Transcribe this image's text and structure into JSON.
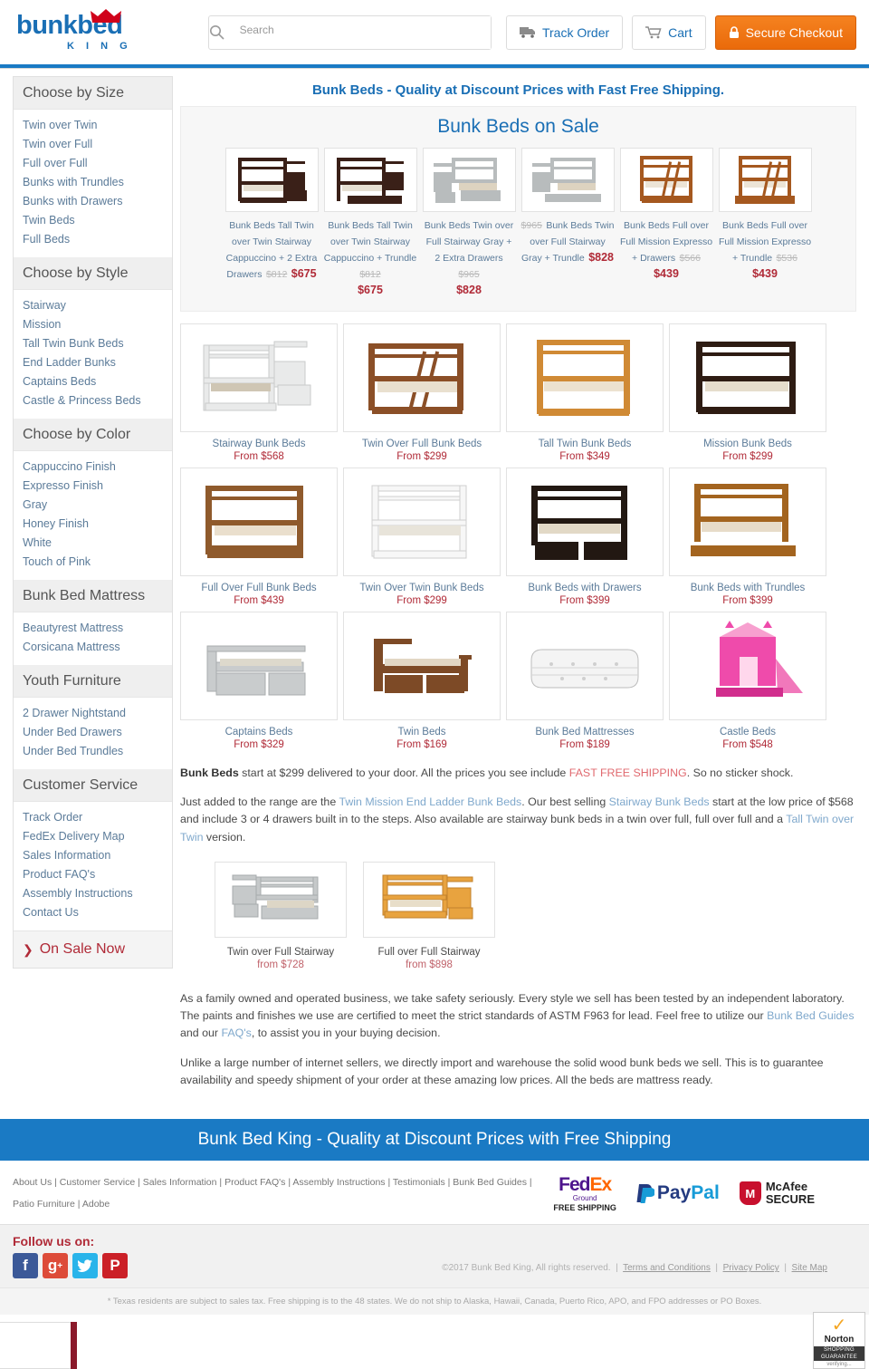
{
  "header": {
    "logo_main": "bunkbed",
    "logo_sub": "K I N G",
    "search_placeholder": "Search",
    "search_value": "",
    "track_order": "Track Order",
    "cart": "Cart",
    "secure_checkout": "Secure Checkout",
    "accent_orange": "#f58220",
    "accent_blue": "#1a7ac4"
  },
  "sidebar": {
    "sections": [
      {
        "title": "Choose by Size",
        "items": [
          "Twin over Twin",
          "Twin over Full",
          "Full over Full",
          "Bunks with Trundles",
          "Bunks with Drawers",
          "Twin Beds",
          "Full Beds"
        ]
      },
      {
        "title": "Choose by Style",
        "items": [
          "Stairway",
          "Mission",
          "Tall Twin Bunk Beds",
          "End Ladder Bunks",
          "Captains Beds",
          "Castle & Princess Beds"
        ]
      },
      {
        "title": "Choose by Color",
        "items": [
          "Cappuccino Finish",
          "Expresso Finish",
          "Gray",
          "Honey Finish",
          "White",
          "Touch of Pink"
        ]
      },
      {
        "title": "Bunk Bed Mattress",
        "items": [
          "Beautyrest Mattress",
          "Corsicana Mattress"
        ]
      },
      {
        "title": "Youth Furniture",
        "items": [
          "2 Drawer Nightstand",
          "Under Bed Drawers",
          "Under Bed Trundles"
        ]
      },
      {
        "title": "Customer Service",
        "items": [
          "Track Order",
          "FedEx Delivery Map",
          "Sales Information",
          "Product FAQ's",
          "Assembly Instructions",
          "Contact Us"
        ]
      }
    ],
    "on_sale_now": "On Sale Now"
  },
  "main": {
    "tagline": "Bunk Beds - Quality at Discount Prices with Fast Free Shipping.",
    "sale_title": "Bunk Beds on Sale",
    "sale_items": [
      {
        "name": "Bunk Beds Tall Twin over Twin Stairway Cappuccino + 2 Extra Drawers",
        "old_price": "$812",
        "price": "$675",
        "color": "#3a2018"
      },
      {
        "name": "Bunk Beds Tall Twin over Twin Stairway Cappuccino + Trundle",
        "old_price": "$812",
        "price": "$675",
        "color": "#3a2018"
      },
      {
        "name": "Bunk Beds Twin over Full Stairway Gray + 2 Extra Drawers",
        "old_price": "$965",
        "price": "$828",
        "color": "#b8bcbd"
      },
      {
        "name": "Bunk Beds Twin over Full Stairway Gray + Trundle",
        "old_price": "$965",
        "price": "$828",
        "color": "#b8bcbd"
      },
      {
        "name": "Bunk Beds Full over Full Mission Expresso + Drawers",
        "old_price": "$566",
        "price": "$439",
        "color": "#a5581f"
      },
      {
        "name": "Bunk Beds Full over Full Mission Expresso + Trundle",
        "old_price": "$536",
        "price": "$439",
        "color": "#a5581f"
      }
    ],
    "categories": [
      {
        "name": "Stairway Bunk Beds",
        "price": "From $568",
        "color": "#e9eaea",
        "stroke": "#c9cbcb"
      },
      {
        "name": "Twin Over Full Bunk Beds",
        "price": "From $299",
        "color": "#8b4f27",
        "stroke": "#6d3c1c"
      },
      {
        "name": "Tall Twin Bunk Beds",
        "price": "From $349",
        "color": "#d08a35",
        "stroke": "#a96c26"
      },
      {
        "name": "Mission Bunk Beds",
        "price": "From $299",
        "color": "#2e1c13",
        "stroke": "#1b100a"
      },
      {
        "name": "Full Over Full Bunk Beds",
        "price": "From $439",
        "color": "#8f5a2c",
        "stroke": "#6d4220"
      },
      {
        "name": "Twin Over Twin Bunk Beds",
        "price": "From $299",
        "color": "#f2f2f2",
        "stroke": "#cfcfcf"
      },
      {
        "name": "Bunk Beds with Drawers",
        "price": "From $399",
        "color": "#221812",
        "stroke": "#120c08"
      },
      {
        "name": "Bunk Beds with Trundles",
        "price": "From $399",
        "color": "#a3641f",
        "stroke": "#7d4b16"
      },
      {
        "name": "Captains Beds",
        "price": "From $329",
        "color": "#c9cccd",
        "stroke": "#a9adae"
      },
      {
        "name": "Twin Beds",
        "price": "From $169",
        "color": "#7d4a26",
        "stroke": "#5e371c"
      },
      {
        "name": "Bunk Bed Mattresses",
        "price": "From $189",
        "color": "#f0f0f0",
        "stroke": "#b8b8b8"
      },
      {
        "name": "Castle Beds",
        "price": "From $548",
        "color": "#ef4bab",
        "stroke": "#d12d8d"
      }
    ],
    "paragraph1": {
      "bold": "Bunk Beds",
      "part1": " start at $299 delivered to your door. All the prices you see include ",
      "highlight": "FAST FREE SHIPPING",
      "part2": ". So no sticker shock."
    },
    "paragraph2": {
      "p1": "Just added to the range are the ",
      "link1": "Twin Mission End Ladder Bunk Beds",
      "p2": ". Our best selling ",
      "link2": "Stairway Bunk Beds",
      "p3": " start at the low price of $568 and include 3 or 4 drawers built in to the steps. Also available are stairway bunk beds in a twin over full, full over full and a ",
      "link3": "Tall Twin over Twin",
      "p4": " version."
    },
    "mini_items": [
      {
        "name": "Twin over Full Stairway",
        "price": "from $728",
        "color": "#c6c9ca",
        "stroke": "#a7abac"
      },
      {
        "name": "Full over Full Stairway",
        "price": "from $898",
        "color": "#e8a33f",
        "stroke": "#c2822c"
      }
    ],
    "paragraph3": {
      "p1": "As a family owned and operated business, we take safety seriously. Every style we sell has been tested by an independent laboratory. The paints and finishes we use are certified to meet the strict standards of ASTM F963 for lead. Feel free to utilize our ",
      "link1": "Bunk Bed Guides",
      "p2": " and our ",
      "link2": "FAQ's",
      "p3": ", to assist you in your buying decision."
    },
    "paragraph4": "Unlike a large number of internet sellers, we directly import and warehouse the solid wood bunk beds we sell. This is to guarantee availability and speedy shipment of your order at these amazing low prices. All the beds are mattress ready."
  },
  "footer": {
    "band": "Bunk Bed King - Quality at Discount Prices with Free Shipping",
    "links_row1": [
      "About Us",
      "Customer Service",
      "Sales Information",
      "Product FAQ's",
      "Assembly Instructions",
      "Testimonials",
      "Bunk Bed Guides"
    ],
    "links_row2": [
      "Patio Furniture",
      "Adobe"
    ],
    "badges": {
      "fedex_fed": "Fed",
      "fedex_ex": "Ex",
      "fedex_ground": "Ground",
      "fedex_shipping": "FREE SHIPPING",
      "paypal_a": "Pay",
      "paypal_b": "Pal",
      "mcafee_line1": "McAfee",
      "mcafee_line2": "SECURE"
    },
    "follow_title": "Follow us on:",
    "social": [
      "facebook-icon",
      "google-plus-icon",
      "twitter-icon",
      "pinterest-icon"
    ],
    "copyright": "©2017 Bunk Bed King, All rights reserved.",
    "copy_links": [
      "Terms and Conditions",
      "Privacy Policy",
      "Site Map"
    ],
    "legal": "* Texas residents are subject to sales tax. Free shipping is to the 48 states. We do not ship to Alaska, Hawaii, Canada, Puerto Rico, APO, and FPO addresses or PO Boxes.",
    "norton": {
      "name": "Norton",
      "line1": "SHOPPING",
      "line2": "GUARANTEE",
      "verify": "verifying..."
    }
  }
}
